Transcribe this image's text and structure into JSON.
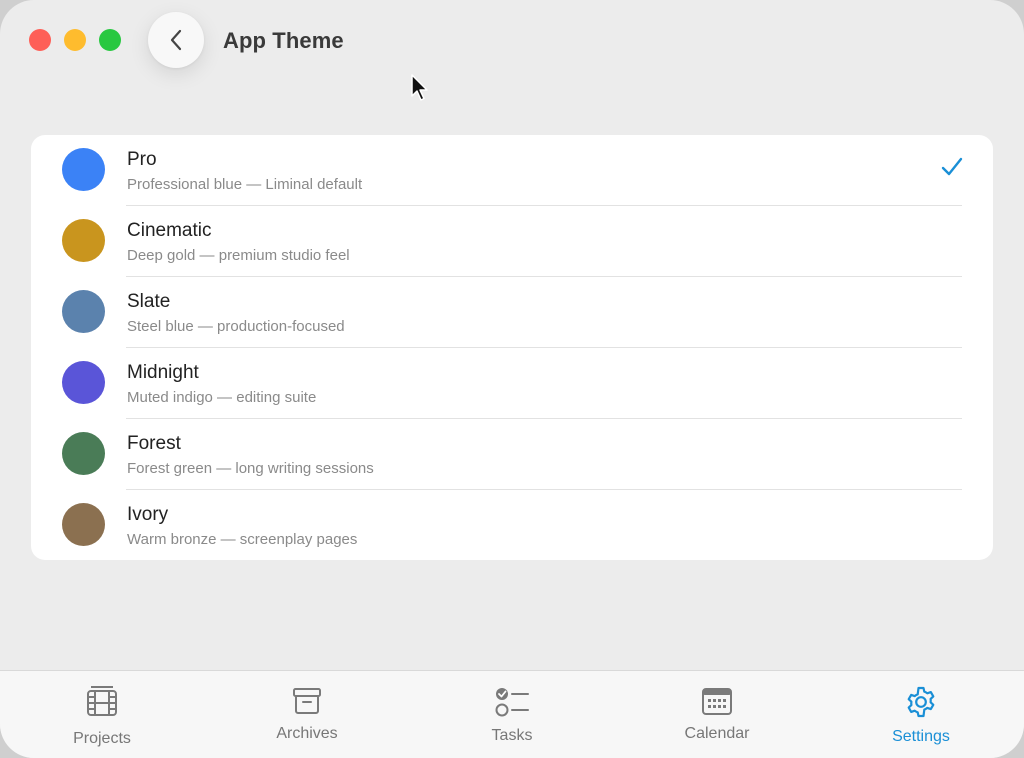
{
  "window": {
    "title": "App Theme"
  },
  "colors": {
    "accent": "#1a8fd6",
    "close": "#fe5f57",
    "minimize": "#febc2e",
    "zoom": "#28c840"
  },
  "themes": [
    {
      "name": "Pro",
      "description": "Professional blue — Liminal default",
      "color": "#3b82f6",
      "selected": true
    },
    {
      "name": "Cinematic",
      "description": "Deep gold — premium studio feel",
      "color": "#c9951e",
      "selected": false
    },
    {
      "name": "Slate",
      "description": "Steel blue — production-focused",
      "color": "#5b82ad",
      "selected": false
    },
    {
      "name": "Midnight",
      "description": "Muted indigo — editing suite",
      "color": "#5a55d8",
      "selected": false
    },
    {
      "name": "Forest",
      "description": "Forest green — long writing sessions",
      "color": "#4a7c57",
      "selected": false
    },
    {
      "name": "Ivory",
      "description": "Warm bronze — screenplay pages",
      "color": "#8b7050",
      "selected": false
    }
  ],
  "tabbar": {
    "tabs": [
      {
        "label": "Projects",
        "icon": "film-icon",
        "active": false
      },
      {
        "label": "Archives",
        "icon": "archive-box-icon",
        "active": false
      },
      {
        "label": "Tasks",
        "icon": "checklist-icon",
        "active": false
      },
      {
        "label": "Calendar",
        "icon": "calendar-icon",
        "active": false
      },
      {
        "label": "Settings",
        "icon": "gear-icon",
        "active": true
      }
    ]
  }
}
